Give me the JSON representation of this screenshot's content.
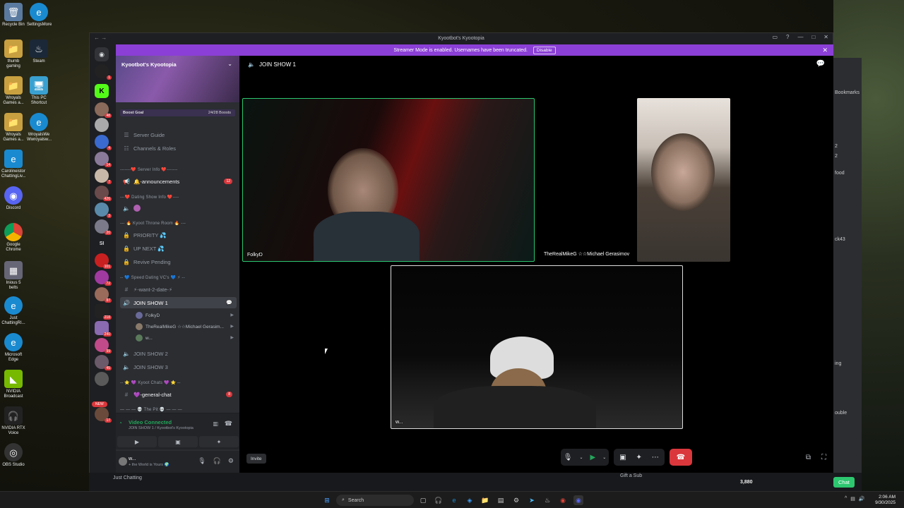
{
  "desktop": {
    "icons_col1": [
      "Recycle Bin",
      "thumb gaming",
      "Wroyals Games a...",
      "Wroyals Games a...",
      "Carolineistor ChattingLiv...",
      "Discord",
      "Google Chrome",
      "Inious 5 belts",
      "Just ChattingRI...",
      "Microsoft Edge",
      "NVIDIA Broadcast",
      "NVIDIA RTX Voice",
      "OBS Studio"
    ],
    "icons_col2": [
      "SettingsMore",
      "Steam",
      "This PC Shortcut",
      "WroyalsWe Wwroyalsw..."
    ]
  },
  "peek": {
    "bookmarks": "Bookmarks",
    "text1": "food",
    "text2": "ck43",
    "text3": "ing",
    "text4": "ouble",
    "counts": [
      "2",
      "2"
    ]
  },
  "window": {
    "title": "Kyootbot's Kyootopia",
    "streamer_banner": "Streamer Mode is enabled. Usernames have been truncated.",
    "disable_label": "Disable"
  },
  "guild_badges": [
    "1",
    "48",
    "4",
    "14",
    "7",
    "426",
    "3",
    "20",
    "101",
    "72",
    "87",
    "218",
    "240",
    "99",
    "45",
    "17"
  ],
  "sl_label": "SI",
  "new_label": "NEW",
  "server": {
    "name": "Kyootbot's Kyootopia",
    "boost_goal": "Boost Goal",
    "boost_count": "24/28 Boosts",
    "server_guide": "Server Guide",
    "channels_roles": "Channels & Roles"
  },
  "categories": {
    "server_info": "-------❤️ Server Info ❤️-------",
    "dating_info": "---❤️ Dating Show Info ❤️----",
    "throne_room": "--- 🔥 Kyoot Throne Room 🔥 ---",
    "speed_dating": "-- 💙 Speed Dating VC's 💙 ⚡ --",
    "kyoot_chats": "-- ⭐ 💜 Kyoot Chats 💜 ⭐ --",
    "the_pit": "— — — 💀 The Pit 💀 — — —"
  },
  "channels": {
    "announcements": "🔔-announcements",
    "announcements_badge": "12",
    "priority": "PRIORITY 💦",
    "up_next": "UP NEXT 💦",
    "revive_pending": "Revive Pending",
    "want_2_date": "⚡-want-2-date-⚡",
    "join_show_1": "JOIN SHOW 1",
    "join_show_2": "JOIN SHOW 2",
    "join_show_3": "JOIN SHOW 3",
    "general_chat": "💜-general-chat",
    "general_badge": "8"
  },
  "voice_users": [
    "FolkyD",
    "TheRealMikeG ☆☆Michael Gerasim...",
    "w..."
  ],
  "vc_panel": {
    "title": "Video Connected",
    "subtitle": "JOIN SHOW 1 / Kyootbot's Kyootopia"
  },
  "user_panel": {
    "name": "w...",
    "status": "+ the World is Yours 🌍"
  },
  "main": {
    "channel": "JOIN SHOW 1",
    "tiles": [
      "FolkyD",
      "TheRealMikeG ☆☆Michael Gerasimov",
      "w..."
    ],
    "invite_label": "Invite"
  },
  "strip": {
    "just_chatting": "Just Chatting",
    "gift_sub": "Gift a Sub",
    "points": "3,880",
    "chat_label": "Chat"
  },
  "taskbar": {
    "search_placeholder": "Search",
    "time": "2:06 AM",
    "date": "9/30/2025"
  }
}
